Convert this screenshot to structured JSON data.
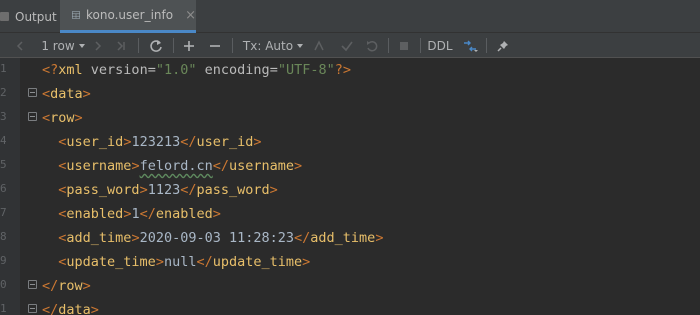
{
  "tabs": [
    {
      "label": "Output",
      "active": false
    },
    {
      "label": "kono.user_info",
      "active": true,
      "close": "×"
    }
  ],
  "toolbar": {
    "rows_label": "1 row",
    "tx_label": "Tx: Auto",
    "ddl_label": "DDL"
  },
  "editor": {
    "line_numbers": [
      "1",
      "2",
      "3",
      "4",
      "5",
      "6",
      "7",
      "8",
      "9",
      "0",
      "1"
    ],
    "lines": [
      {
        "text": "<?xml version=\"1.0\" encoding=\"UTF-8\"?>"
      },
      {
        "text": "<data>"
      },
      {
        "text": "<row>"
      },
      {
        "text": "<user_id>123213</user_id>"
      },
      {
        "text": "<username>felord.cn</username>"
      },
      {
        "text": "<pass_word>1123</pass_word>"
      },
      {
        "text": "<enabled>1</enabled>"
      },
      {
        "text": "<add_time>2020-09-03 11:28:23</add_time>"
      },
      {
        "text": "<update_time>null</update_time>"
      },
      {
        "text": "</row>"
      },
      {
        "text": "</data>"
      }
    ],
    "xml_decl": {
      "version": "1.0",
      "encoding": "UTF-8"
    },
    "fields": [
      {
        "tag": "user_id",
        "value": "123213"
      },
      {
        "tag": "username",
        "value": "felord.cn"
      },
      {
        "tag": "pass_word",
        "value": "1123"
      },
      {
        "tag": "enabled",
        "value": "1"
      },
      {
        "tag": "add_time",
        "value": "2020-09-03 11:28:23"
      },
      {
        "tag": "update_time",
        "value": "null"
      }
    ],
    "root_tag": "data",
    "row_tag": "row"
  },
  "colors": {
    "background": "#2b2b2b",
    "toolbar": "#3c3f41",
    "tag": "#e8bf6a",
    "bracket": "#cc7832",
    "string": "#6a8759",
    "text": "#a9b7c6",
    "accent": "#4a88c7"
  },
  "icons": [
    "table-icon",
    "prev-icon",
    "next-icon",
    "last-icon",
    "refresh-icon",
    "add-row-icon",
    "delete-row-icon",
    "tx-dropdown-icon",
    "commit-icon",
    "rollback-icon",
    "stop-icon",
    "compare-icon",
    "pin-icon"
  ]
}
